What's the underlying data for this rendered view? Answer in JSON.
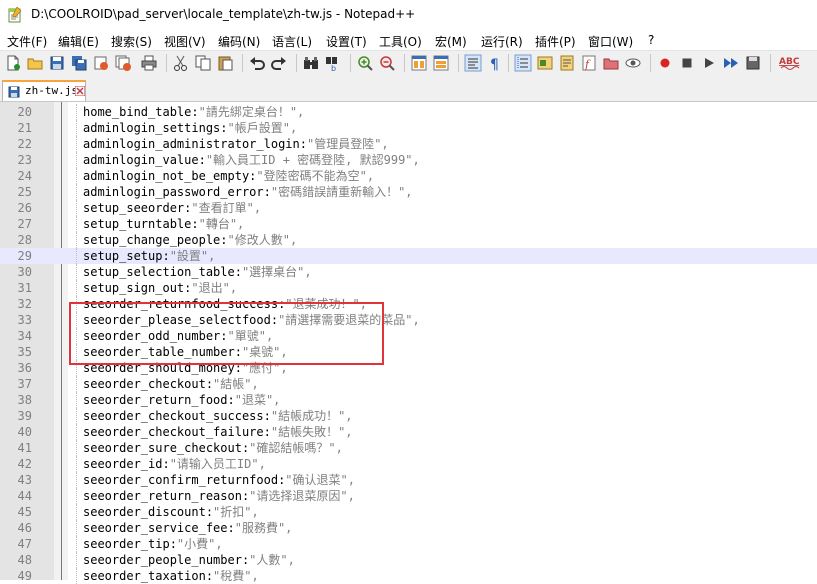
{
  "window": {
    "title": "D:\\COOLROID\\pad_server\\locale_template\\zh-tw.js - Notepad++"
  },
  "menu": [
    "文件(F)",
    "编辑(E)",
    "搜索(S)",
    "视图(V)",
    "编码(N)",
    "语言(L)",
    "设置(T)",
    "工具(O)",
    "宏(M)",
    "运行(R)",
    "插件(P)",
    "窗口(W)",
    "?"
  ],
  "tab": {
    "label": "zh-tw.js"
  },
  "editor": {
    "current_line": 29,
    "lines": [
      {
        "num": "20",
        "key": "home_bind_table:",
        "val": "\"請先綁定桌台！\","
      },
      {
        "num": "21",
        "key": "adminlogin_settings:",
        "val": "\"帳戶設置\","
      },
      {
        "num": "22",
        "key": "adminlogin_administrator_login:",
        "val": "\"管理員登陸\","
      },
      {
        "num": "23",
        "key": "adminlogin_value:",
        "val": "\"輸入員工ID + 密碼登陸, 默認999\","
      },
      {
        "num": "24",
        "key": "adminlogin_not_be_empty:",
        "val": "\"登陸密碼不能為空\","
      },
      {
        "num": "25",
        "key": "adminlogin_password_error:",
        "val": "\"密碼錯誤請重新輸入！\","
      },
      {
        "num": "26",
        "key": "setup_seeorder:",
        "val": "\"查看訂單\","
      },
      {
        "num": "27",
        "key": "setup_turntable:",
        "val": "\"轉台\","
      },
      {
        "num": "28",
        "key": "setup_change_people:",
        "val": "\"修改人數\","
      },
      {
        "num": "29",
        "key": "setup_setup:",
        "val": "\"設置\","
      },
      {
        "num": "30",
        "key": "setup_selection_table:",
        "val": "\"選擇桌台\","
      },
      {
        "num": "31",
        "key": "setup_sign_out:",
        "val": "\"退出\","
      },
      {
        "num": "32",
        "key": "seeorder_returnfood_success:",
        "val": "\"退菜成功！\","
      },
      {
        "num": "33",
        "key": "seeorder_please_selectfood:",
        "val": "\"請選擇需要退菜的菜品\","
      },
      {
        "num": "34",
        "key": "seeorder_odd_number:",
        "val": "\"單號\","
      },
      {
        "num": "35",
        "key": "seeorder_table_number:",
        "val": "\"桌號\","
      },
      {
        "num": "36",
        "key": "seeorder_should_money:",
        "val": "\"應付\","
      },
      {
        "num": "37",
        "key": "seeorder_checkout:",
        "val": "\"結帳\","
      },
      {
        "num": "38",
        "key": "seeorder_return_food:",
        "val": "\"退菜\","
      },
      {
        "num": "39",
        "key": "seeorder_checkout_success:",
        "val": "\"結帳成功！\","
      },
      {
        "num": "40",
        "key": "seeorder_checkout_failure:",
        "val": "\"結帳失敗！\","
      },
      {
        "num": "41",
        "key": "seeorder_sure_checkout:",
        "val": "\"確認結帳嗎？\","
      },
      {
        "num": "42",
        "key": "seeorder_id:",
        "val": "\"请输入员工ID\","
      },
      {
        "num": "43",
        "key": "seeorder_confirm_returnfood:",
        "val": "\"确认退菜\","
      },
      {
        "num": "44",
        "key": "seeorder_return_reason:",
        "val": "\"请选择退菜原因\","
      },
      {
        "num": "45",
        "key": "seeorder_discount:",
        "val": "\"折扣\","
      },
      {
        "num": "46",
        "key": "seeorder_service_fee:",
        "val": "\"服務費\","
      },
      {
        "num": "47",
        "key": "seeorder_tip:",
        "val": "\"小費\","
      },
      {
        "num": "48",
        "key": "seeorder_people_number:",
        "val": "\"人數\","
      },
      {
        "num": "49",
        "key": "seeorder_taxation:",
        "val": "\"稅費\","
      }
    ]
  },
  "toolbar": {
    "icons": [
      "new-file-icon",
      "open-file-icon",
      "save-icon",
      "save-all-icon",
      "close-icon",
      "close-all-icon",
      "print-icon",
      "cut-icon",
      "copy-icon",
      "paste-icon",
      "undo-icon",
      "redo-icon",
      "find-icon",
      "replace-icon",
      "zoom-in-icon",
      "zoom-out-icon",
      "sync-vertical-icon",
      "sync-horizontal-icon",
      "word-wrap-icon",
      "show-all-chars-icon",
      "indent-guide-icon",
      "user-lang-icon",
      "doc-map-icon",
      "function-list-icon",
      "folder-workspace-icon",
      "monitor-icon",
      "record-macro-icon",
      "stop-record-icon",
      "play-macro-icon",
      "run-macro-multiple-icon",
      "save-macro-icon",
      "spell-check-icon"
    ]
  },
  "highlight": {
    "box_color": "#e2333b",
    "current_line_color": "#e8e8ff",
    "tab_accent": "#f8a33b"
  }
}
